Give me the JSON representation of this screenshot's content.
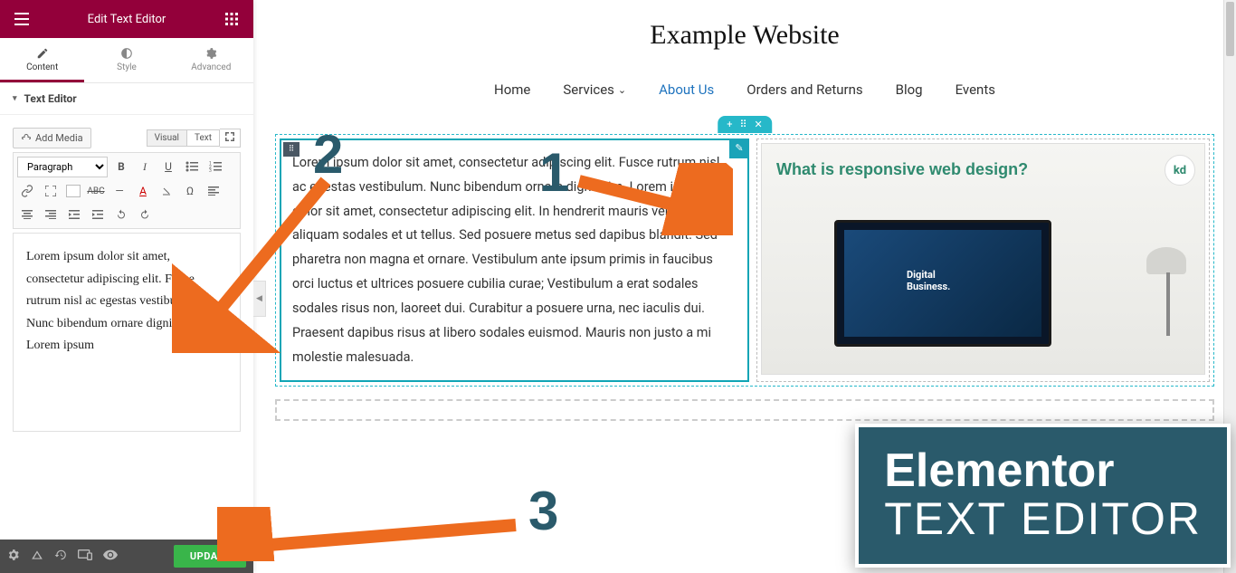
{
  "panel": {
    "title": "Edit Text Editor",
    "tabs": {
      "content": "Content",
      "style": "Style",
      "advanced": "Advanced"
    },
    "section_label": "Text Editor",
    "add_media": "Add Media",
    "view_tabs": {
      "visual": "Visual",
      "text": "Text"
    },
    "paragraph_label": "Paragraph",
    "content_text": "Lorem ipsum dolor sit amet, consectetur adipiscing elit. Fusce rutrum nisl ac egestas vestibulum. Nunc bibendum ornare dignissim. Lorem ipsum",
    "update_label": "UPDATE"
  },
  "preview": {
    "site_title": "Example Website",
    "nav": {
      "home": "Home",
      "services": "Services",
      "about": "About Us",
      "orders": "Orders and Returns",
      "blog": "Blog",
      "events": "Events"
    },
    "text_widget": "Lorem ipsum dolor sit amet, consectetur adipiscing elit. Fusce rutrum nisl ac egestas vestibulum. Nunc bibendum ornare dignissim. Lorem ipsum dolor sit amet, consectetur adipiscing elit. In hendrerit mauris vel magna aliquam sodales et ut tellus. Sed posuere metus sed dapibus blandit. Sed pharetra non magna et ornare. Vestibulum ante ipsum primis in faucibus orci luctus et ultrices posuere cubilia curae; Vestibulum a erat sodales sodales risus non, laoreet dui. Curabitur a posuere urna, nec iaculis dui. Praesent dapibus risus at libero sodales euismod. Mauris non justo a mi molestie malesuada.",
    "image": {
      "headline": "What is responsive web design?",
      "kd": "kd",
      "db": "Digital\nBusiness."
    }
  },
  "badge": {
    "line1": "Elementor",
    "line2": "TEXT EDITOR"
  },
  "annotations": {
    "n1": "1",
    "n2": "2",
    "n3": "3"
  }
}
